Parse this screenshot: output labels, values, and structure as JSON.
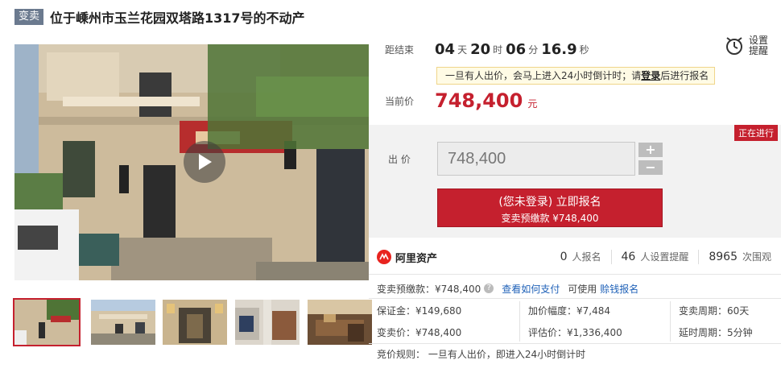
{
  "header": {
    "tag": "变卖",
    "title": "位于嵊州市玉兰花园双塔路1317号的不动产"
  },
  "gallery": {
    "thumbnail_count": 5,
    "active_index": 0
  },
  "countdown": {
    "label": "距结束",
    "days": "04",
    "days_unit": "天",
    "hours": "20",
    "hours_unit": "时",
    "minutes": "06",
    "minutes_unit": "分",
    "seconds": "16.9",
    "seconds_unit": "秒"
  },
  "reminder": {
    "label_line1": "设置",
    "label_line2": "提醒"
  },
  "notice": {
    "text_before": "一旦有人出价，会马上进入24小时倒计时；请",
    "login": "登录",
    "text_after": "后进行报名"
  },
  "price": {
    "label": "当前价",
    "value": "748,400",
    "unit": "元"
  },
  "bid": {
    "status": "正在进行",
    "label": "出  价",
    "input_value": "748,400",
    "plus": "+",
    "minus": "−",
    "button_line1": "(您未登录) 立即报名",
    "button_line2": "变卖预缴款 ¥748,400"
  },
  "stats": {
    "brand": "阿里资产",
    "signups_count": "0",
    "signups_label": "人报名",
    "reminders_count": "46",
    "reminders_label": "人设置提醒",
    "views_count": "8965",
    "views_label": "次围观"
  },
  "deposit": {
    "label": "变卖预缴款：¥748,400",
    "help": "?",
    "how_to_pay": "查看如何支付",
    "can_use": "可使用",
    "credit_link": "赊钱报名"
  },
  "info": {
    "guarantee": "保证金：¥149,680",
    "increment": "加价幅度：¥7,484",
    "cycle": "变卖周期：60天",
    "sale_price": "变卖价：¥748,400",
    "appraisal": "评估价：¥1,336,400",
    "delay": "延时周期：5分钟",
    "rule": "竞价规则： 一旦有人出价，即进入24小时倒计时"
  },
  "colors": {
    "accent": "#c5202e",
    "tag_bg": "#6b7a8f",
    "link": "#2062b8",
    "notice_bg": "#fffbe5"
  }
}
